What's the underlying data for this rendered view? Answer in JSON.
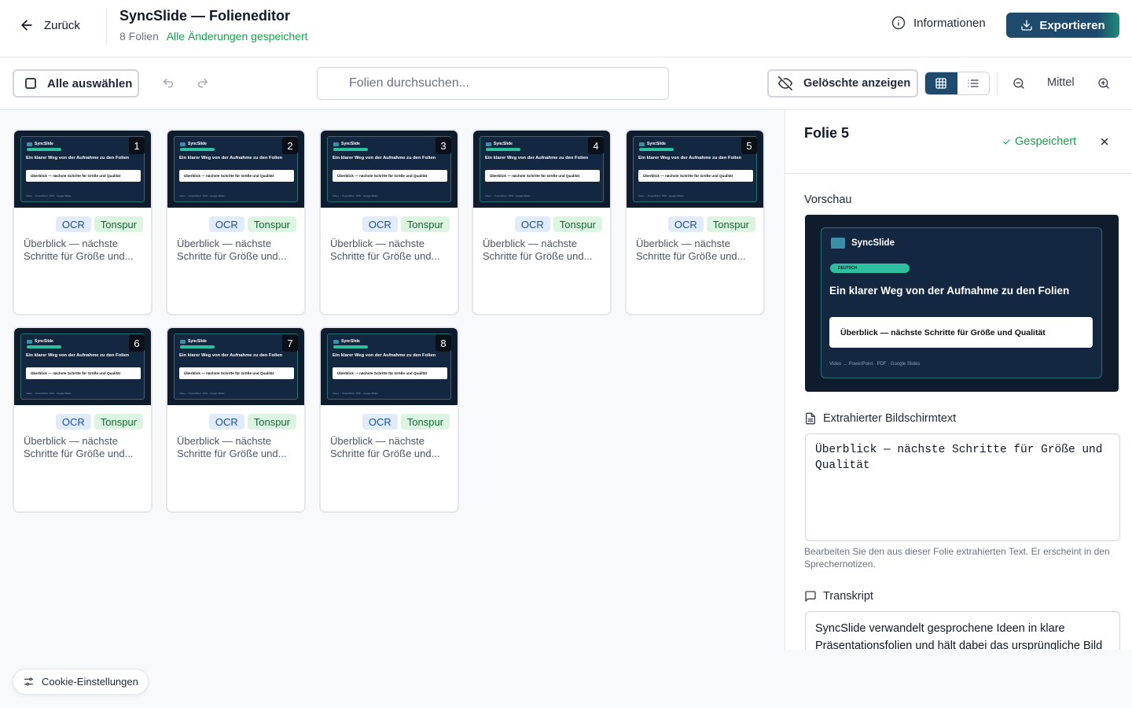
{
  "header": {
    "back_label": "Zurück",
    "title": "SyncSlide — Folieneditor",
    "slide_count": "8 Folien",
    "save_status": "Alle Änderungen gespeichert",
    "info_label": "Informationen",
    "export_label": "Exportieren"
  },
  "toolbar": {
    "select_all_label": "Alle auswählen",
    "search_placeholder": "Folien durchsuchen...",
    "deleted_label": "Gelöschte anzeigen",
    "view_mode": "grid",
    "zoom_label": "Mittel"
  },
  "slide_template": {
    "brand": "SyncSlide",
    "title": "Ein klarer Weg von der Aufnahme zu den Folien",
    "box_text": "Überblick — nächste Schritte für Größe und Qualität",
    "footer": "Video → PowerPoint · PDF · Google Slides"
  },
  "slides": [
    {
      "number": "1",
      "tags": [
        "OCR",
        "Tonspur"
      ],
      "text": "Überblick — nächste Schritte für Größe und..."
    },
    {
      "number": "2",
      "tags": [
        "OCR",
        "Tonspur"
      ],
      "text": "Überblick — nächste Schritte für Größe und..."
    },
    {
      "number": "3",
      "tags": [
        "OCR",
        "Tonspur"
      ],
      "text": "Überblick — nächste Schritte für Größe und..."
    },
    {
      "number": "4",
      "tags": [
        "OCR",
        "Tonspur"
      ],
      "text": "Überblick — nächste Schritte für Größe und..."
    },
    {
      "number": "5",
      "tags": [
        "OCR",
        "Tonspur"
      ],
      "text": "Überblick — nächste Schritte für Größe und..."
    },
    {
      "number": "6",
      "tags": [
        "OCR",
        "Tonspur"
      ],
      "text": "Überblick — nächste Schritte für Größe und..."
    },
    {
      "number": "7",
      "tags": [
        "OCR",
        "Tonspur"
      ],
      "text": "Überblick — nächste Schritte für Größe und..."
    },
    {
      "number": "8",
      "tags": [
        "OCR",
        "Tonspur"
      ],
      "text": "Überblick — nächste Schritte für Größe und..."
    }
  ],
  "panel": {
    "title": "Folie 5",
    "saved_label": "Gespeichert",
    "preview_label": "Vorschau",
    "preview": {
      "brand": "SyncSlide",
      "pill": "DEUTSCH",
      "title": "Ein klarer Weg von der Aufnahme zu den Folien",
      "box_text": "Überblick — nächste Schritte für Größe und Qualität",
      "footer": "Video → PowerPoint · PDF · Google Slides"
    },
    "extracted_label": "Extrahierter Bildschirmtext",
    "extracted_text": "Überblick — nächste Schritte für Größe und Qualität",
    "extracted_hint": "Bearbeiten Sie den aus dieser Folie extrahierten Text. Er erscheint in den Sprechernotizen.",
    "transcript_label": "Transkript",
    "transcript_text": "SyncSlide verwandelt gesprochene Ideen in klare Präsentationsfolien und hält dabei das ursprüngliche Bild"
  },
  "cookie_label": "Cookie-Einstellungen",
  "colors": {
    "primary": "#1e4a6e",
    "success": "#16a34a",
    "accent": "#2fbfa0"
  }
}
